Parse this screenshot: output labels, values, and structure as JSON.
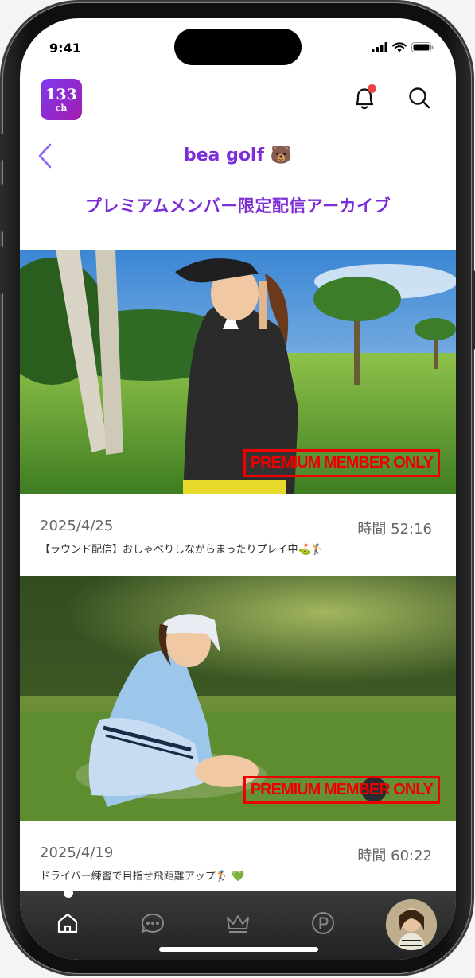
{
  "status_bar": {
    "time": "9:41"
  },
  "header": {
    "logo_number": "133",
    "logo_suffix": "ch"
  },
  "channel": {
    "title": "bea golf 🐻"
  },
  "section": {
    "title": "プレミアムメンバー限定配信アーカイブ"
  },
  "videos": [
    {
      "badge": "PREMIUM MEMBER ONLY",
      "date": "2025/4/25",
      "duration": "時間 52:16",
      "description": "【ラウンド配信】おしゃべりしながらまったりプレイ中⛳🏌️"
    },
    {
      "badge": "PREMIUM MEMBER ONLY",
      "date": "2025/4/19",
      "duration": "時間 60:22",
      "description": "ドライバー練習で目指せ飛距離アップ🏌️ 💚"
    }
  ],
  "tab_bar": {
    "items": [
      {
        "icon": "home-icon",
        "active": true
      },
      {
        "icon": "chat-icon",
        "active": false
      },
      {
        "icon": "crown-icon",
        "active": false
      },
      {
        "icon": "points-icon",
        "active": false
      },
      {
        "icon": "profile-avatar",
        "active": false
      }
    ]
  },
  "colors": {
    "accent": "#7c2fd6",
    "badge_red": "#e00000",
    "notification": "#ef4444"
  }
}
